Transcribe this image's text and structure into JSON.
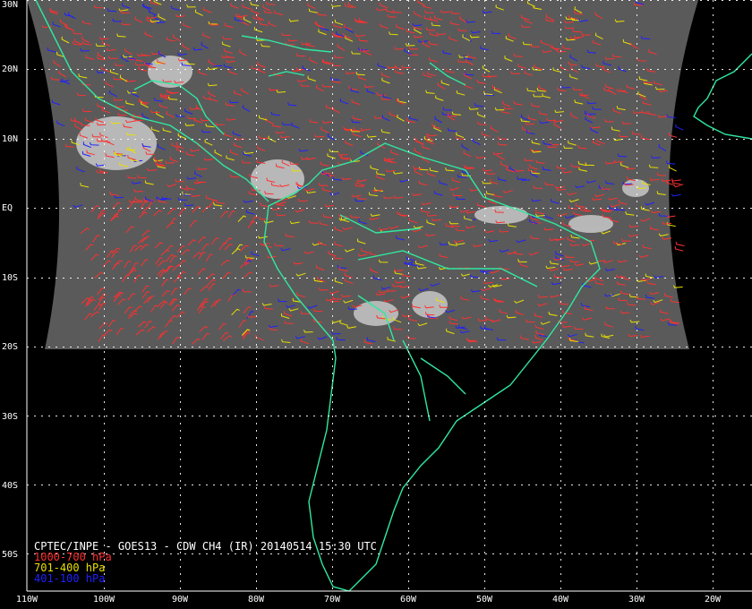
{
  "title": "CPTEC/INPE - GOES13 - CDW CH4 (IR) 20140514 15:30 UTC",
  "legend": [
    {
      "label": "1000-700 hPa",
      "color": "#ff3030"
    },
    {
      "label": "701-400 hPa",
      "color": "#e8e000"
    },
    {
      "label": "401-100 hPa",
      "color": "#2020ff"
    }
  ],
  "lat_labels": [
    "30N",
    "20N",
    "10N",
    "EQ",
    "10S",
    "20S",
    "30S",
    "40S",
    "50S"
  ],
  "lon_labels": [
    "110W",
    "100W",
    "90W",
    "80W",
    "70W",
    "60W",
    "50W",
    "40W",
    "30W",
    "20W"
  ],
  "colors": {
    "background": "#000000",
    "coastline": "#30e8a0",
    "grid": "#ffffff",
    "satellite_image": "#5a5a5a"
  },
  "map": {
    "lat_range": [
      -55,
      30
    ],
    "lon_range": [
      -110,
      -15
    ],
    "image_coverage_lat": [
      -20,
      30
    ],
    "projection": "equirectangular"
  }
}
